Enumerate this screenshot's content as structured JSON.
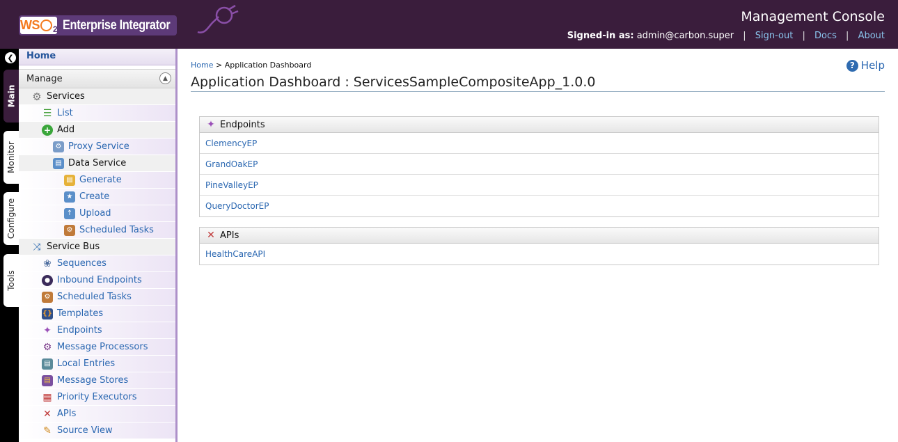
{
  "header": {
    "logo_wso": "WS",
    "logo_two": "2",
    "product": "Enterprise Integrator",
    "console_title": "Management Console",
    "signed_in_label": "Signed-in as:",
    "user": "admin@carbon.super",
    "sign_out": "Sign-out",
    "docs": "Docs",
    "about": "About"
  },
  "vtabs": {
    "main": "Main",
    "monitor": "Monitor",
    "configure": "Configure",
    "tools": "Tools"
  },
  "menu": {
    "home": "Home",
    "manage": "Manage",
    "items": [
      {
        "label": "Services",
        "icon": "gear-icon"
      },
      {
        "label": "List",
        "icon": "list-icon"
      },
      {
        "label": "Add",
        "icon": "add-icon"
      },
      {
        "label": "Proxy Service",
        "icon": "proxy-service-icon"
      },
      {
        "label": "Data Service",
        "icon": "database-icon"
      },
      {
        "label": "Generate",
        "icon": "generate-icon"
      },
      {
        "label": "Create",
        "icon": "create-icon"
      },
      {
        "label": "Upload",
        "icon": "upload-icon"
      },
      {
        "label": "Scheduled Tasks",
        "icon": "scheduled-tasks-icon"
      },
      {
        "label": "Service Bus",
        "icon": "service-bus-icon"
      },
      {
        "label": "Sequences",
        "icon": "sequences-icon"
      },
      {
        "label": "Inbound Endpoints",
        "icon": "inbound-endpoints-icon"
      },
      {
        "label": "Scheduled Tasks",
        "icon": "scheduled-tasks-icon"
      },
      {
        "label": "Templates",
        "icon": "templates-icon"
      },
      {
        "label": "Endpoints",
        "icon": "endpoints-icon"
      },
      {
        "label": "Message Processors",
        "icon": "message-processors-icon"
      },
      {
        "label": "Local Entries",
        "icon": "local-entries-icon"
      },
      {
        "label": "Message Stores",
        "icon": "message-stores-icon"
      },
      {
        "label": "Priority Executors",
        "icon": "priority-executors-icon"
      },
      {
        "label": "APIs",
        "icon": "apis-icon"
      },
      {
        "label": "Source View",
        "icon": "source-view-icon"
      }
    ]
  },
  "main": {
    "breadcrumb_home": "Home",
    "breadcrumb_sep": ">",
    "breadcrumb_current": "Application Dashboard",
    "help": "Help",
    "title": "Application Dashboard : ServicesSampleCompositeApp_1.0.0",
    "endpoints_header": "Endpoints",
    "endpoints": [
      "ClemencyEP",
      "GrandOakEP",
      "PineValleyEP",
      "QueryDoctorEP"
    ],
    "apis_header": "APIs",
    "apis": [
      "HealthCareAPI"
    ]
  },
  "colors": {
    "header_bg": "#3a1d3c",
    "link": "#2a67b1",
    "menu_border": "#ad90c9"
  }
}
